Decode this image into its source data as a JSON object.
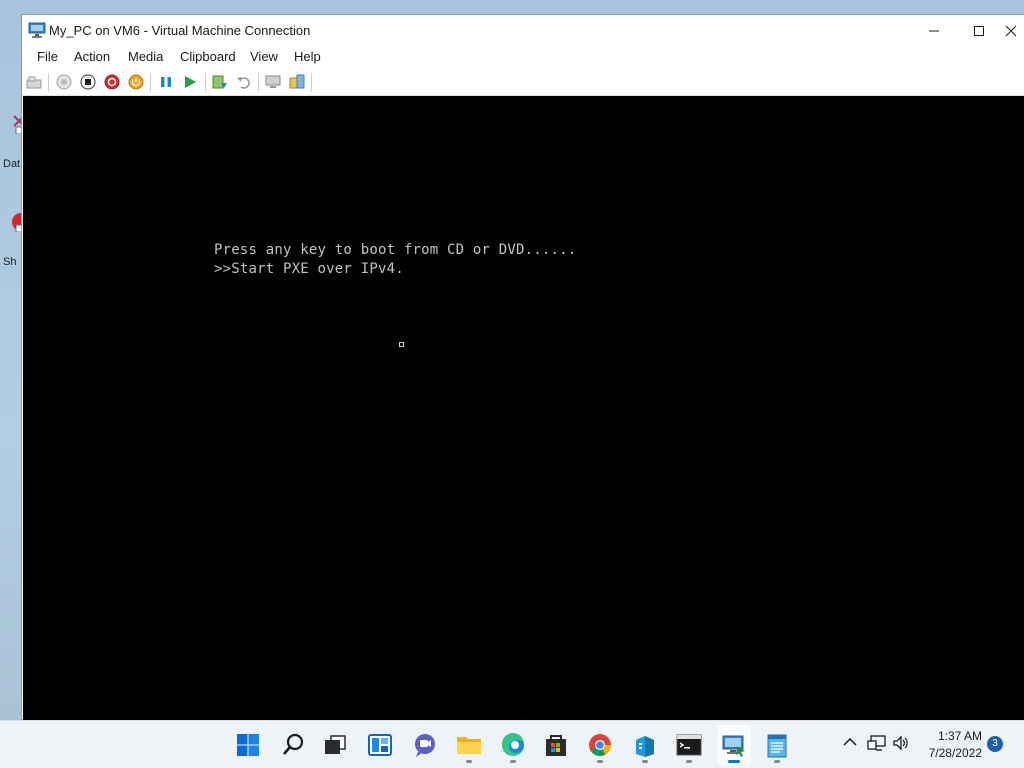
{
  "desktop": {
    "icons": [
      {
        "label": "Dat"
      },
      {
        "label": "Sh"
      }
    ]
  },
  "window": {
    "title": "My_PC on VM6 - Virtual Machine Connection",
    "menu": [
      "File",
      "Action",
      "Media",
      "Clipboard",
      "View",
      "Help"
    ]
  },
  "toolbar": {
    "buttons": [
      "ctrl-alt-del",
      "start",
      "turn-off",
      "shut-down",
      "power",
      "pause",
      "resume",
      "checkpoint",
      "revert",
      "enhanced-session",
      "share"
    ]
  },
  "console": {
    "line1": "Press any key to boot from CD or DVD......",
    "line2": ">>Start PXE over IPv4."
  },
  "taskbar": {
    "apps": [
      "windows-start",
      "search",
      "task-view",
      "widgets",
      "teams-chat",
      "file-explorer",
      "edge",
      "microsoft-store",
      "chrome",
      "server-manager",
      "command-prompt",
      "hyper-v-connection",
      "notepad"
    ],
    "clock_time": "1:37 AM",
    "clock_date": "7/28/2022",
    "notification_count": "3"
  },
  "colors": {
    "accent": "#0078d4",
    "console_bg": "#000000",
    "console_text": "#c2c2c2"
  }
}
